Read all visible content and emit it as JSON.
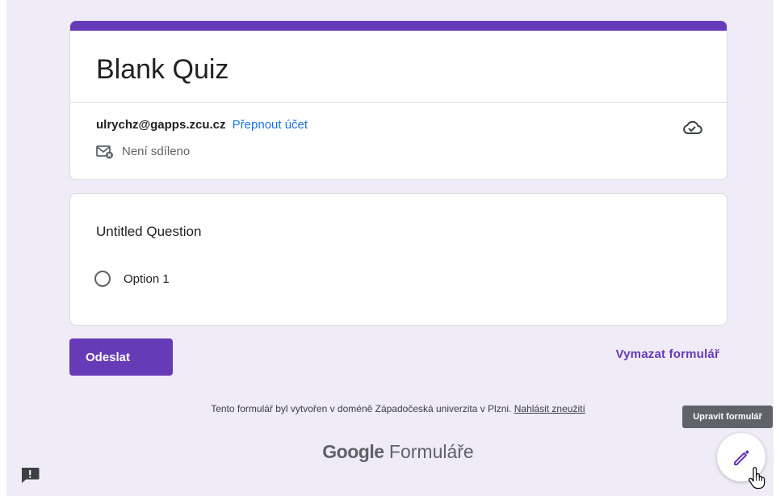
{
  "form": {
    "title": "Blank Quiz",
    "account_email": "ulrychz@gapps.zcu.cz",
    "switch_account_label": "Přepnout účet",
    "sharing_status": "Není sdíleno",
    "accent_color": "#673ab7",
    "link_color": "#1a73e8"
  },
  "question": {
    "title": "Untitled Question",
    "options": [
      {
        "label": "Option 1"
      }
    ]
  },
  "actions": {
    "submit_label": "Odeslat",
    "clear_label": "Vymazat formulář"
  },
  "footer": {
    "created_text": "Tento formulář byl vytvořen v doméně Západočeská univerzita v Plzni.",
    "report_link": "Nahlásit zneužití",
    "brand_google": "Google",
    "brand_product": "Formuláře"
  },
  "edit": {
    "tooltip": "Upravit formulář"
  },
  "icons": {
    "cloud": "cloud-saved-icon",
    "mail": "mail-not-shared-icon",
    "report": "report-problem-icon",
    "edit": "pencil-icon",
    "cursor": "hand-pointer-icon"
  }
}
